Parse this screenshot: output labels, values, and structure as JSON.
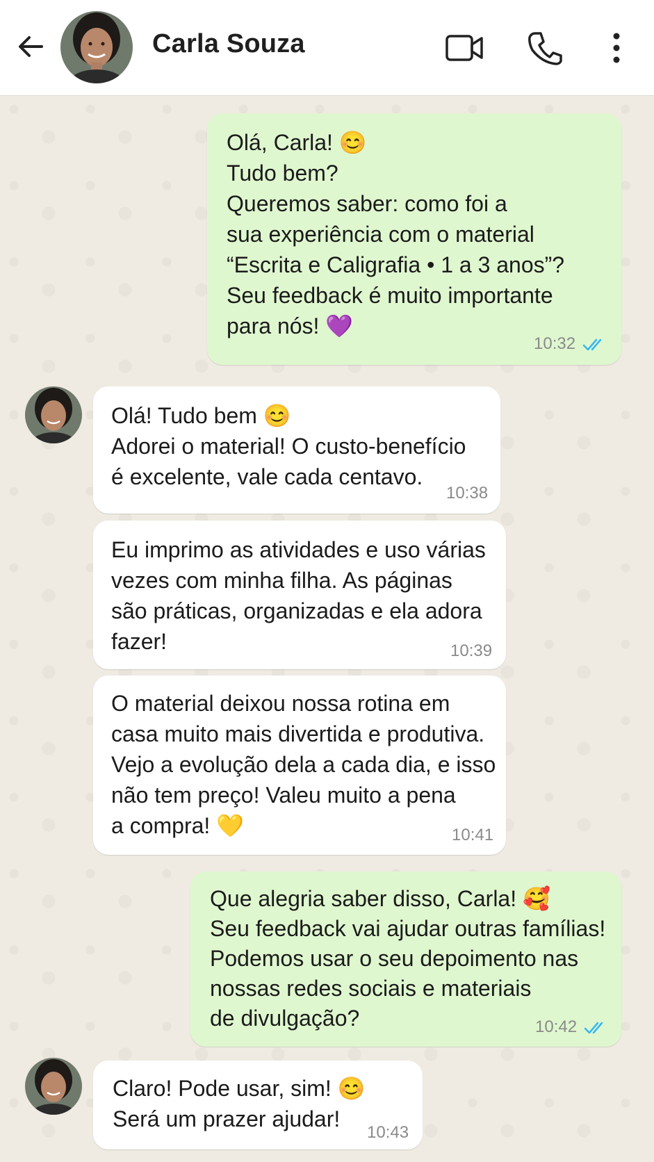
{
  "header": {
    "contact_name": "Carla Souza",
    "back_icon": "arrow-left-icon",
    "video_icon": "video-camera-icon",
    "call_icon": "phone-icon",
    "menu_icon": "more-vertical-icon"
  },
  "colors": {
    "outgoing_bubble": "#dff7cf",
    "incoming_bubble": "#ffffff",
    "chat_background": "#efeae2",
    "read_ticks": "#34b7f1"
  },
  "messages": [
    {
      "direction": "outgoing",
      "text": "Olá, Carla! 😊\nTudo bem?\nQueremos saber: como foi a\nsua experiência com o material\n“Escrita e Caligrafia • 1 a 3 anos”?\nSeu feedback é muito importante\npara nós! 💜",
      "time": "10:32",
      "status": "read"
    },
    {
      "direction": "incoming",
      "text": "Olá! Tudo bem 😊\nAdorei o material! O custo-benefício\né excelente, vale cada centavo.",
      "time": "10:38"
    },
    {
      "direction": "incoming",
      "text": "Eu imprimo as atividades e uso várias\nvezes com minha filha. As páginas\nsão práticas, organizadas e ela adora\nfazer!",
      "time": "10:39"
    },
    {
      "direction": "incoming",
      "text": "O material deixou nossa rotina em\ncasa muito mais divertida e produtiva.\nVejo a evolução dela a cada dia, e isso\nnão tem preço! Valeu muito a pena\na compra! 💛",
      "time": "10:41"
    },
    {
      "direction": "outgoing",
      "text": "Que alegria saber disso, Carla! 🥰\nSeu feedback vai ajudar outras famílias!\nPodemos usar o seu depoimento nas\nnossas redes sociais e materiais\nde divulgação?",
      "time": "10:42",
      "status": "read"
    },
    {
      "direction": "incoming",
      "text": "Claro! Pode usar, sim! 😊\nSerá um prazer ajudar!",
      "time": "10:43"
    }
  ]
}
